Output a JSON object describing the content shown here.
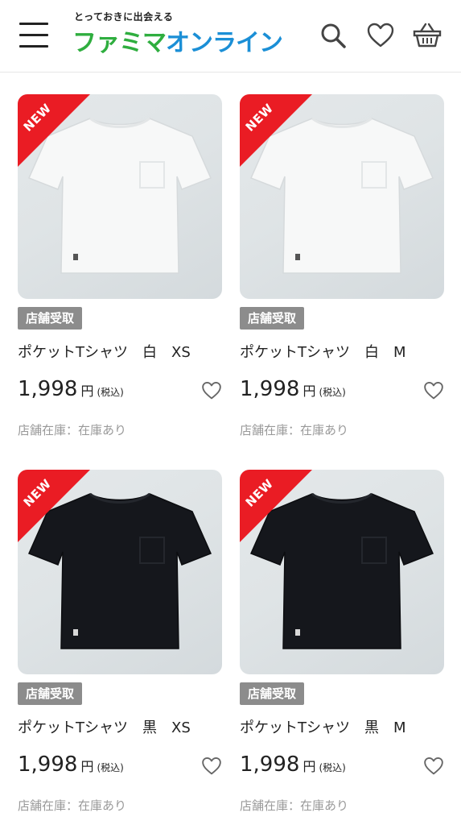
{
  "header": {
    "logo_sub": "とっておきに出会える",
    "logo_main_part1": "ファミマ",
    "logo_main_part2": "オンライン",
    "icons": [
      "menu-icon",
      "search-icon",
      "heart-icon",
      "basket-icon"
    ]
  },
  "colors": {
    "new_badge": "#ea1c24",
    "tag_bg": "#8c8c8c",
    "logo_green": "#2fae3f",
    "logo_blue": "#1b8fd6"
  },
  "products": [
    {
      "badge": "NEW",
      "tag": "店舗受取",
      "name": "ポケットTシャツ　白　XS",
      "price": "1,998",
      "currency": "円",
      "tax": "(税込)",
      "stock": "店舗在庫：在庫あり",
      "shirt_color": "white"
    },
    {
      "badge": "NEW",
      "tag": "店舗受取",
      "name": "ポケットTシャツ　白　M",
      "price": "1,998",
      "currency": "円",
      "tax": "(税込)",
      "stock": "店舗在庫：在庫あり",
      "shirt_color": "white"
    },
    {
      "badge": "NEW",
      "tag": "店舗受取",
      "name": "ポケットTシャツ　黒　XS",
      "price": "1,998",
      "currency": "円",
      "tax": "(税込)",
      "stock": "店舗在庫：在庫あり",
      "shirt_color": "black"
    },
    {
      "badge": "NEW",
      "tag": "店舗受取",
      "name": "ポケットTシャツ　黒　M",
      "price": "1,998",
      "currency": "円",
      "tax": "(税込)",
      "stock": "店舗在庫：在庫あり",
      "shirt_color": "black"
    }
  ]
}
